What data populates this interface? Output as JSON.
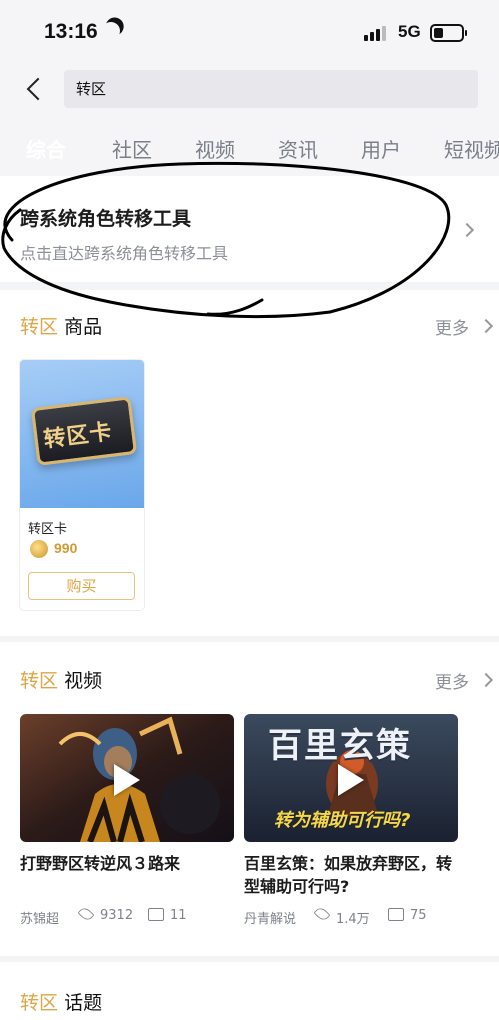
{
  "status_bar": {
    "time": "13:16",
    "network": "5G",
    "icons": [
      "moon-icon",
      "signal-icon",
      "battery-icon"
    ]
  },
  "search": {
    "query": "转区",
    "back_icon": "chevron-left-icon"
  },
  "tabs": [
    "综合",
    "社区",
    "视频",
    "资讯",
    "用户",
    "短视频"
  ],
  "tool": {
    "title": "跨系统角色转移工具",
    "desc": "点击直达跨系统角色转移工具"
  },
  "goods": {
    "keyword": "转区",
    "label": "商品",
    "more": "更多",
    "product": {
      "art_text": "转区卡",
      "name": "转区卡",
      "price": "990",
      "buy": "购买"
    }
  },
  "videos": {
    "keyword": "转区",
    "label": "视频",
    "more": "更多",
    "items": [
      {
        "title": "打野野区转逆风３路来",
        "author": "苏锦超",
        "views": "9312",
        "comments": "11"
      },
      {
        "title": "百里玄策：如果放弃野区，转型辅助可行吗?",
        "author": "丹青解说",
        "views": "1.4万",
        "comments": "75",
        "thumb_top": "百里玄策",
        "thumb_bottom": "转为辅助可行吗?"
      }
    ]
  },
  "topics": {
    "keyword": "转区",
    "label": "话题"
  },
  "colors": {
    "accent": "#e0a546",
    "tab_active_bg": "#e9b65c",
    "muted": "#8c9098"
  }
}
